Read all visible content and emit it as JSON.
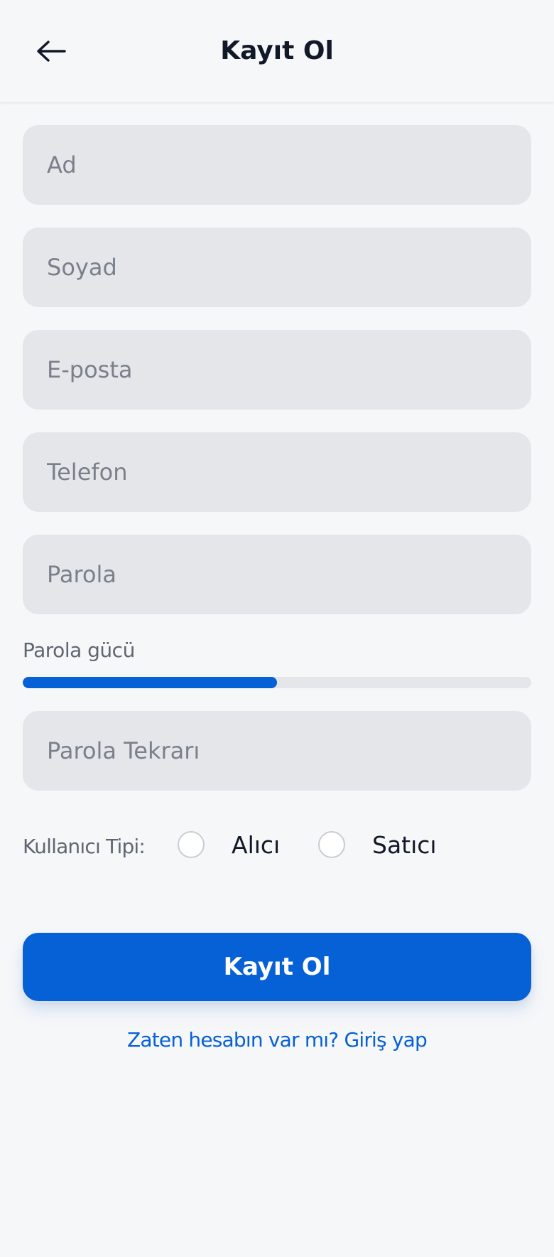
{
  "header": {
    "title": "Kayıt Ol",
    "back_icon": "arrow-left-icon"
  },
  "form": {
    "first_name": {
      "placeholder": "Ad",
      "value": ""
    },
    "last_name": {
      "placeholder": "Soyad",
      "value": ""
    },
    "email": {
      "placeholder": "E-posta",
      "value": ""
    },
    "phone": {
      "placeholder": "Telefon",
      "value": ""
    },
    "password": {
      "placeholder": "Parola",
      "value": ""
    },
    "password_strength": {
      "label": "Parola gücü",
      "level": 0.5
    },
    "password_confirm": {
      "placeholder": "Parola Tekrarı",
      "value": ""
    },
    "user_type": {
      "label": "Kullanıcı Tipi:",
      "options": [
        "Alıcı",
        "Satıcı"
      ],
      "selected": null
    },
    "submit_label": "Kayıt Ol",
    "login_link": "Zaten hesabın var mı? Giriş yap"
  },
  "colors": {
    "accent": "#0660d6",
    "background": "#f6f7f9",
    "field_background": "#e5e6ea",
    "text_primary": "#111827",
    "text_secondary": "#5f6671"
  }
}
